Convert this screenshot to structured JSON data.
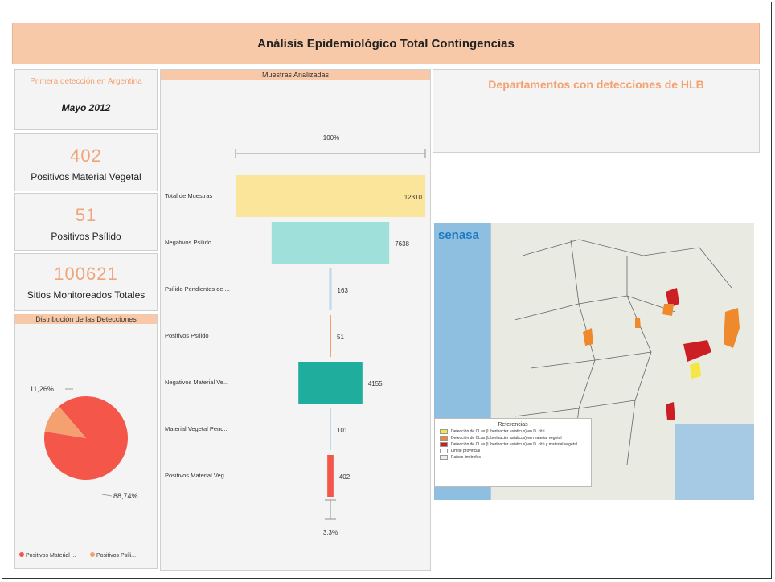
{
  "header": {
    "title": "Análisis Epidemiológico Total Contingencias"
  },
  "kpis": {
    "first_detection_label": "Primera detección en Argentina",
    "first_detection_value": "Mayo 2012",
    "positivos_material_value": "402",
    "positivos_material_label": "Positivos Material Vegetal",
    "positivos_psilido_value": "51",
    "positivos_psilido_label": "Positivos Psílido",
    "sitios_value": "100621",
    "sitios_label": "Sitios Monitoreados Totales"
  },
  "distribution": {
    "title": "Distribución de las Detecciones",
    "label_small": "11,26%",
    "label_large": "88,74%",
    "legend": [
      "Positivos Material ...",
      "Positivos Psíli..."
    ],
    "colors": {
      "material": "#f4564a",
      "psilido": "#f4a070"
    }
  },
  "muestras": {
    "title": "Muestras Analizadas",
    "top_percent": "100%",
    "bottom_percent": "3,3%"
  },
  "deptos": {
    "title": "Departamentos con detecciones de HLB"
  },
  "map": {
    "brand": "senasa",
    "legend_title": "Referencias",
    "legend_items": [
      {
        "label": "Detección de CLas (Liberibacter asiaticus) en D. citri",
        "color": "#f6e640"
      },
      {
        "label": "Detección de CLas (Liberibacter asiaticus) en material vegetal",
        "color": "#ee8a2c"
      },
      {
        "label": "Detección de CLas (Liberibacter asiaticus) en D. citri y material vegetal",
        "color": "#cc1f24"
      },
      {
        "label": "Límite provincial",
        "color": "#ffffff"
      },
      {
        "label": "Países limítrofes",
        "color": "#eeeeee"
      }
    ]
  },
  "chart_data": [
    {
      "type": "bar",
      "title": "Muestras Analizadas",
      "categories": [
        "Total de Muestras",
        "Negativos Psílido",
        "Psílido Pendientes de ...",
        "Positivos Psílido",
        "Negativos Material Ve...",
        "Material Vegetal Pend...",
        "Positivos Material Veg..."
      ],
      "values": [
        12310,
        7638,
        163,
        51,
        4155,
        101,
        402
      ],
      "value_labels": [
        "12310",
        "7638",
        "163",
        "51",
        "4155",
        "101",
        "402"
      ],
      "colors": [
        "#fbe59a",
        "#9fe0da",
        "#bfd9ec",
        "#f4a070",
        "#1fae9e",
        "#bfd9ec",
        "#f4564a"
      ]
    },
    {
      "type": "pie",
      "title": "Distribución de las Detecciones",
      "categories": [
        "Positivos Material Vegetal",
        "Positivos Psílido"
      ],
      "values": [
        88.74,
        11.26
      ]
    }
  ]
}
